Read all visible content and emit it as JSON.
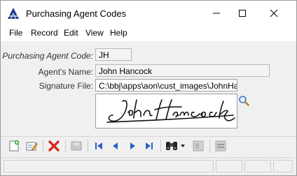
{
  "window": {
    "title": "Purchasing Agent Codes",
    "controls": {
      "minimize": "minimize",
      "maximize": "maximize",
      "close": "close"
    }
  },
  "menu": {
    "file": "File",
    "record": "Record",
    "edit": "Edit",
    "view": "View",
    "help": "Help"
  },
  "form": {
    "code_label": "Purchasing Agent Code:",
    "code_value": "JH",
    "name_label": "Agent's Name:",
    "name_value": "John Hancock",
    "signature_label": "Signature File:",
    "signature_value": "C:\\bbj\\apps\\aon\\cust_images\\JohnHancock"
  },
  "toolbar": {
    "icons": [
      "new-record",
      "edit-record",
      "delete",
      "save",
      "first",
      "previous",
      "next",
      "last",
      "find",
      "find-dropdown",
      "lookup",
      "options"
    ]
  },
  "colors": {
    "delete": "#d42a20",
    "nav": "#2a62c9",
    "text": "#000000"
  }
}
